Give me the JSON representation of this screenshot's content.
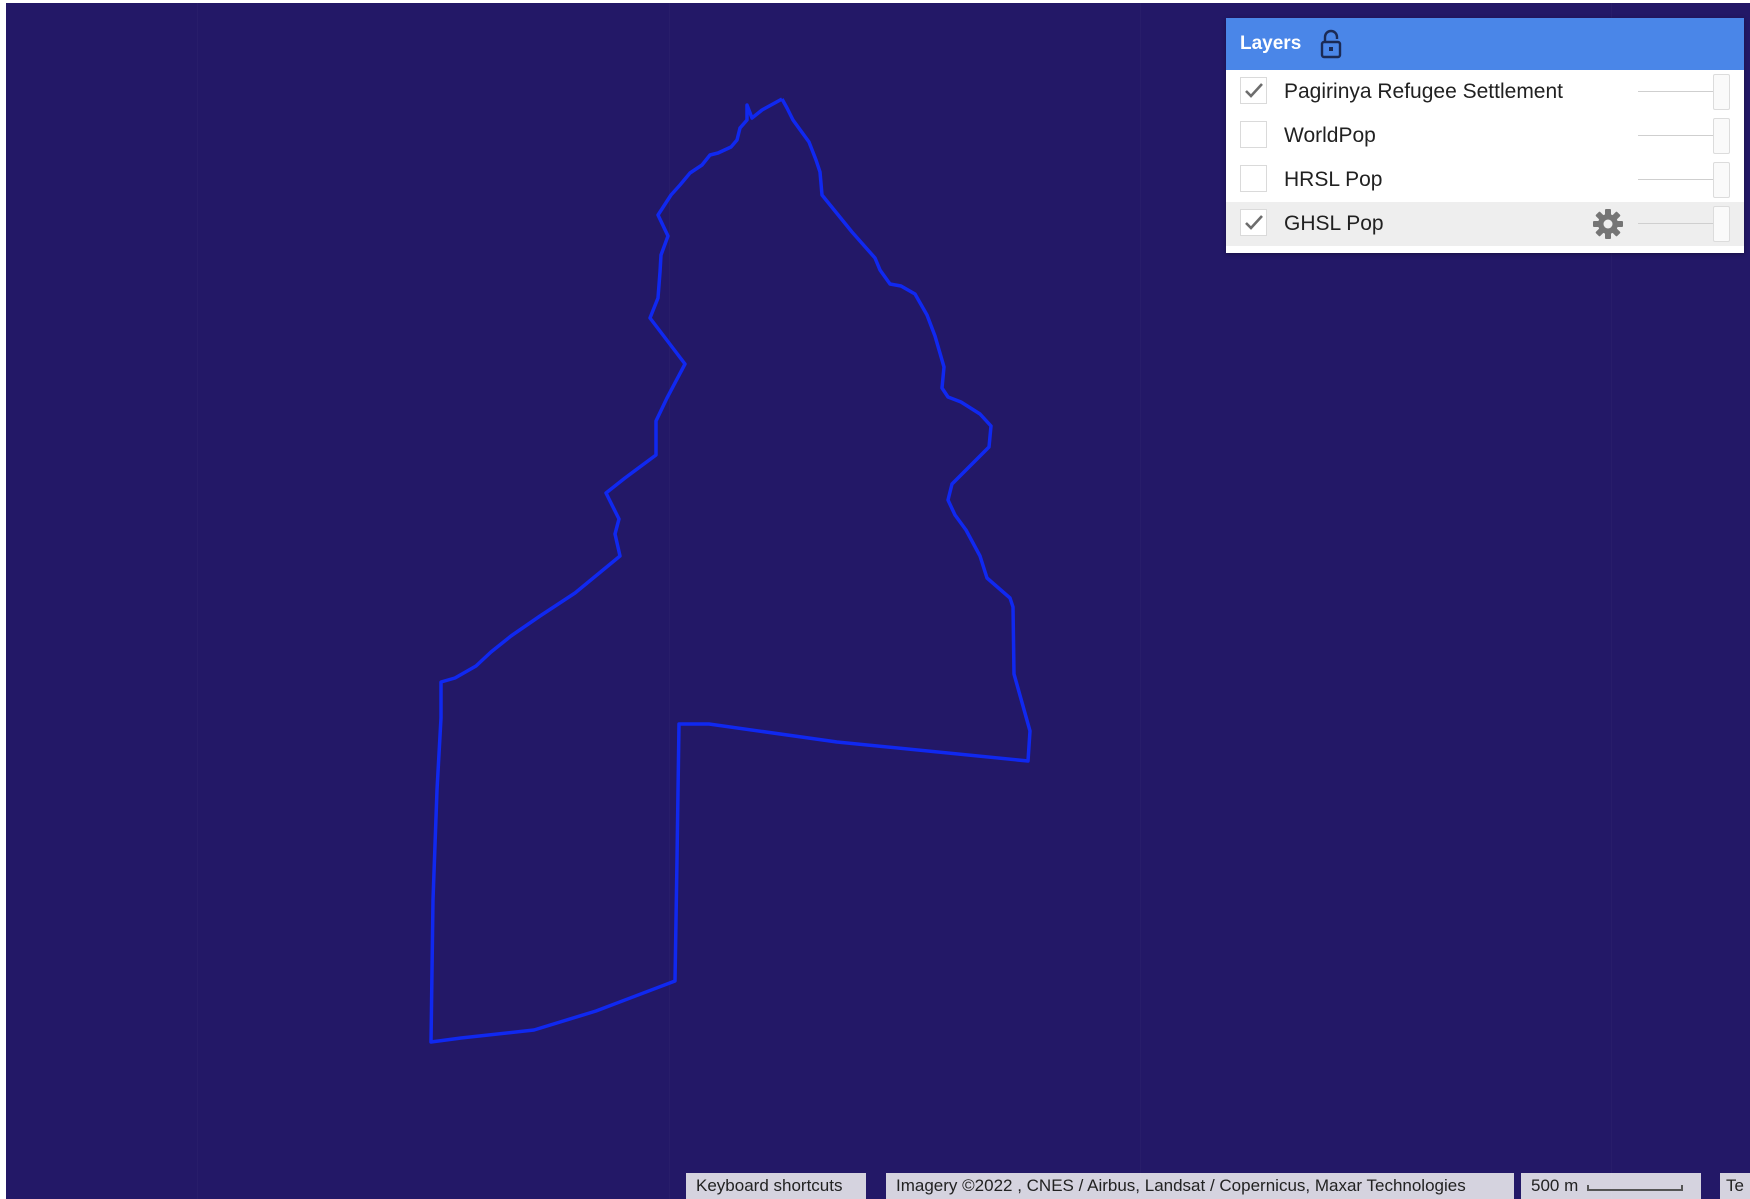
{
  "map": {
    "background_color": "#231867",
    "boundary_color": "#1028f0",
    "boundary_name": "Pagirinya Refugee Settlement"
  },
  "layers_panel": {
    "title": "Layers",
    "header_color": "#4a86e8",
    "lock_icon": "lock-icon",
    "items": [
      {
        "label": "Pagirinya Refugee Settlement",
        "checked": true
      },
      {
        "label": "WorldPop",
        "checked": false
      },
      {
        "label": "HRSL Pop",
        "checked": false
      },
      {
        "label": "GHSL Pop",
        "checked": true,
        "settings_icon": "gear-icon"
      }
    ]
  },
  "footer": {
    "keyboard_shortcuts": "Keyboard shortcuts",
    "imagery_attribution": "Imagery ©2022 , CNES / Airbus, Landsat / Copernicus, Maxar Technologies",
    "scale_label": "500 m",
    "terms": "Te"
  }
}
